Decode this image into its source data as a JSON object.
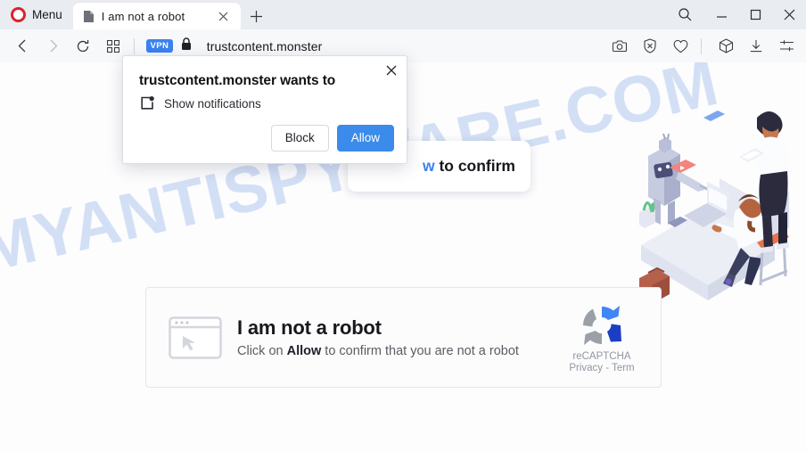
{
  "browser": {
    "menu_label": "Menu",
    "tab": {
      "title": "I am not a robot",
      "favicon": "page-icon",
      "close": "×"
    },
    "new_tab": "+",
    "window_controls": {
      "search": "search-icon",
      "minimize": "−",
      "maximize": "□",
      "close": "×"
    },
    "nav": {
      "back": "back-icon",
      "forward": "forward-icon",
      "reload": "reload-icon",
      "tab_grid": "grid-icon"
    },
    "address": {
      "vpn_badge": "VPN",
      "lock": "lock-icon",
      "url": "trustcontent.monster"
    },
    "right_icons": [
      "camera-icon",
      "shield-x-icon",
      "heart-icon",
      "cube-icon",
      "download-icon",
      "settings-sliders-icon"
    ]
  },
  "page": {
    "watermark": "MYANTISPYWARE.COM",
    "top_banner": {
      "visible_text": "w to confirm",
      "blue_fragment": "w"
    },
    "captcha": {
      "icon": "browser-window-cursor-icon",
      "heading": "I am not a robot",
      "body_prefix": "Click on ",
      "body_strong": "Allow",
      "body_suffix": " to confirm that you are not a robot",
      "recaptcha": {
        "logo": "recaptcha-logo",
        "label": "reCAPTCHA",
        "links": "Privacy - Term"
      }
    },
    "illustration": "office-robot-workers-illustration"
  },
  "dialog": {
    "title": "trustcontent.monster wants to",
    "permission_icon": "notification-bell-icon",
    "permission_label": "Show notifications",
    "block_label": "Block",
    "allow_label": "Allow",
    "close_label": "×"
  },
  "colors": {
    "accent_blue": "#3b8bea",
    "vpn_blue": "#3b82f0",
    "watermark_blue": "#b9cdf0",
    "chrome_tabbar": "#e9ecf1",
    "chrome_navbar": "#f7f8fa",
    "opera_red": "#d9232e"
  }
}
